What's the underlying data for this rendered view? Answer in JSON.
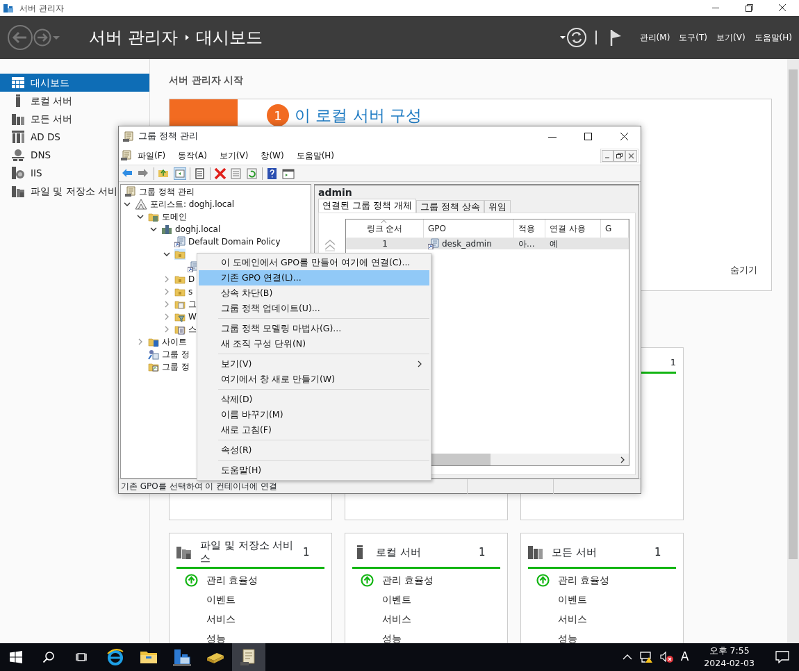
{
  "window": {
    "title": "서버 관리자"
  },
  "header": {
    "breadcrumb": [
      "서버 관리자",
      "대시보드"
    ],
    "menus": [
      "관리(M)",
      "도구(T)",
      "보기(V)",
      "도움말(H)"
    ]
  },
  "sidebar": {
    "items": [
      {
        "label": "대시보드",
        "kind": "dashboard",
        "selected": true
      },
      {
        "label": "로컬 서버",
        "kind": "server",
        "selected": false
      },
      {
        "label": "모든 서버",
        "kind": "servers",
        "selected": false
      },
      {
        "label": "AD DS",
        "kind": "adds",
        "selected": false
      },
      {
        "label": "DNS",
        "kind": "dns",
        "selected": false
      },
      {
        "label": "IIS",
        "kind": "iis",
        "selected": false
      },
      {
        "label": "파일 및 저장소 서비",
        "kind": "files",
        "selected": false
      }
    ]
  },
  "welcome": {
    "heading": "서버 관리자 시작",
    "step": "1",
    "step_title": "이 로컬 서버 구성",
    "hide": "숨기기"
  },
  "upper_card_count": "1",
  "groups": [
    {
      "title": "파일 및 저장소 서비스",
      "kind": "files",
      "count": "1",
      "items": [
        {
          "label": "관리 효율성",
          "healthy": true
        },
        {
          "label": "이벤트",
          "healthy": false
        },
        {
          "label": "서비스",
          "healthy": false
        },
        {
          "label": "성능",
          "healthy": false
        }
      ]
    },
    {
      "title": "로컬 서버",
      "kind": "server",
      "count": "1",
      "items": [
        {
          "label": "관리 효율성",
          "healthy": true
        },
        {
          "label": "이벤트",
          "healthy": false
        },
        {
          "label": "서비스",
          "healthy": false
        },
        {
          "label": "성능",
          "healthy": false
        }
      ]
    },
    {
      "title": "모든 서버",
      "kind": "servers",
      "count": "1",
      "items": [
        {
          "label": "관리 효율성",
          "healthy": true
        },
        {
          "label": "이벤트",
          "healthy": false
        },
        {
          "label": "서비스",
          "healthy": false
        },
        {
          "label": "성능",
          "healthy": false
        }
      ]
    }
  ],
  "gpm": {
    "title": "그룹 정책 관리",
    "menus": [
      "파일(F)",
      "동작(A)",
      "보기(V)",
      "창(W)",
      "도움말(H)"
    ],
    "tree": [
      {
        "label": "그룹 정책 관리",
        "kind": "gpm",
        "selected": false,
        "children": [
          {
            "label": "포리스트: doghj.local",
            "kind": "forest",
            "expanded": true,
            "selected": false,
            "children": [
              {
                "label": "도메인",
                "kind": "domains",
                "expanded": true,
                "selected": false,
                "children": [
                  {
                    "label": "doghj.local",
                    "kind": "domain",
                    "expanded": true,
                    "selected": false,
                    "children": [
                      {
                        "label": "Default Domain Policy",
                        "kind": "gpo-link",
                        "selected": false
                      },
                      {
                        "kind": "ou",
                        "expanded": true,
                        "selected": true,
                        "children": [
                          {
                            "kind": "gpo-link",
                            "selected": false
                          }
                        ]
                      },
                      {
                        "label": "D",
                        "kind": "ou",
                        "expanded": false,
                        "selected": false
                      },
                      {
                        "label": "s",
                        "kind": "ou",
                        "expanded": false,
                        "selected": false
                      },
                      {
                        "label": "그",
                        "kind": "gpo-folder",
                        "expanded": false,
                        "selected": false
                      },
                      {
                        "label": "W",
                        "kind": "wmi",
                        "expanded": false,
                        "selected": false
                      },
                      {
                        "label": "스",
                        "kind": "starter",
                        "expanded": false,
                        "selected": false
                      }
                    ]
                  }
                ]
              },
              {
                "label": "사이트",
                "kind": "sites",
                "expanded": false,
                "selected": false
              },
              {
                "label": "그룹 정",
                "kind": "modeling",
                "selected": false
              },
              {
                "label": "그룹 정",
                "kind": "results",
                "selected": false
              }
            ]
          }
        ]
      }
    ],
    "pane": {
      "title": "admin",
      "tabs": [
        {
          "label": "연결된 그룹 정책 개체",
          "selected": true
        },
        {
          "label": "그룹 정책 상속",
          "selected": false
        },
        {
          "label": "위임",
          "selected": false
        }
      ],
      "table": {
        "columns": [
          "링크 순서",
          "GPO",
          "적용",
          "연결 사용",
          "G"
        ],
        "rows": [
          {
            "cells": [
              "1",
              "desk_admin",
              "아...",
              "예"
            ],
            "selected": true
          }
        ]
      }
    },
    "status_bar": "기존 GPO를 선택하여 이 컨테이너에 연결"
  },
  "context_menu": {
    "items": [
      {
        "kind": "item",
        "label": "이 도메인에서 GPO를 만들어 여기에 연결(C)...",
        "selected": false
      },
      {
        "kind": "item",
        "label": "기존 GPO 연결(L)...",
        "selected": true
      },
      {
        "kind": "item",
        "label": "상속 차단(B)",
        "selected": false
      },
      {
        "kind": "item",
        "label": "그룹 정책 업데이트(U)...",
        "selected": false
      },
      {
        "kind": "separator"
      },
      {
        "kind": "item",
        "label": "그룹 정책 모델링 마법사(G)...",
        "selected": false
      },
      {
        "kind": "item",
        "label": "새 조직 구성 단위(N)",
        "selected": false
      },
      {
        "kind": "separator"
      },
      {
        "kind": "submenu",
        "label": "보기(V)",
        "selected": false
      },
      {
        "kind": "item",
        "label": "여기에서 창 새로 만들기(W)",
        "selected": false
      },
      {
        "kind": "separator"
      },
      {
        "kind": "item",
        "label": "삭제(D)",
        "selected": false
      },
      {
        "kind": "item",
        "label": "이름 바꾸기(M)",
        "selected": false
      },
      {
        "kind": "item",
        "label": "새로 고침(F)",
        "selected": false
      },
      {
        "kind": "separator"
      },
      {
        "kind": "item",
        "label": "속성(R)",
        "selected": false
      },
      {
        "kind": "separator"
      },
      {
        "kind": "item",
        "label": "도움말(H)",
        "selected": false
      }
    ]
  },
  "taskbar": {
    "buttons": [
      {
        "kind": "start",
        "selected": false
      },
      {
        "kind": "search",
        "selected": false
      },
      {
        "kind": "task-view",
        "selected": false
      },
      {
        "kind": "browser",
        "selected": false
      },
      {
        "kind": "explorer",
        "selected": false
      },
      {
        "kind": "server-manager",
        "selected": false
      },
      {
        "kind": "package",
        "selected": false
      },
      {
        "kind": "gpm",
        "selected": true
      }
    ],
    "ime": "A",
    "time": "오후 7:55",
    "date": "2024-02-03"
  }
}
